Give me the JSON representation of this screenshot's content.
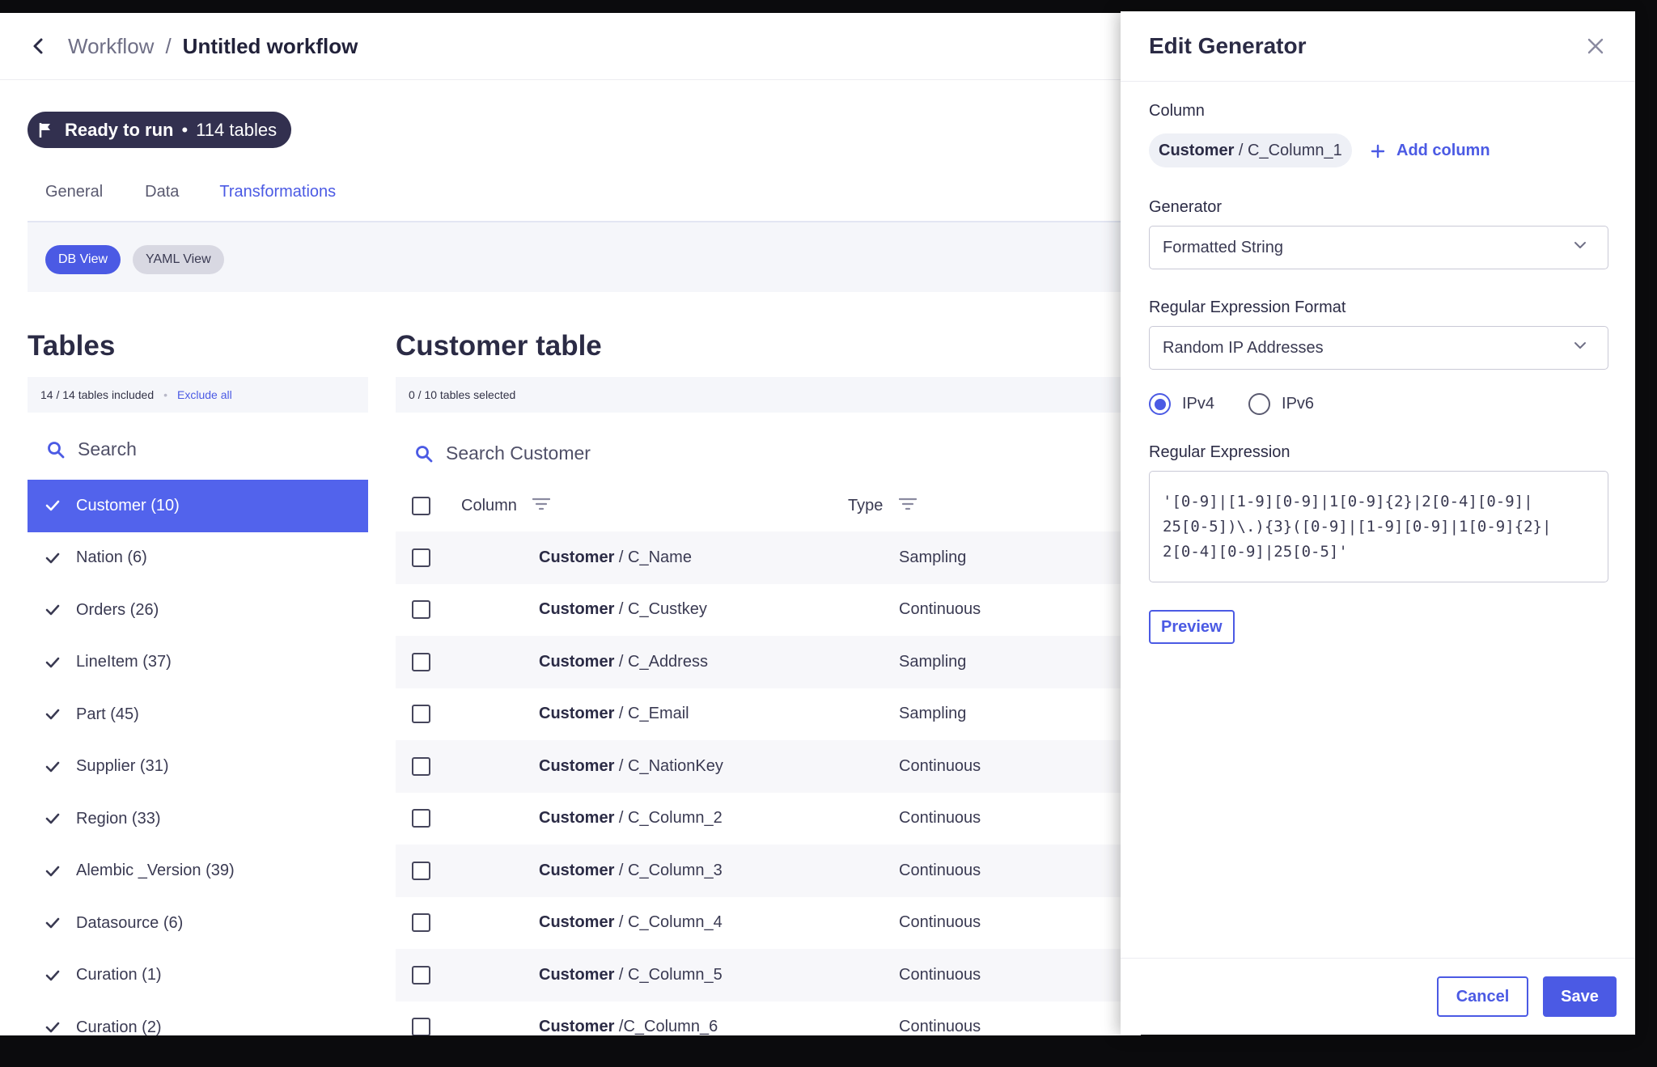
{
  "header": {
    "breadcrumb_parent": "Workflow",
    "breadcrumb_sep": "/",
    "breadcrumb_current": "Untitled workflow"
  },
  "status": {
    "label": "Ready to run",
    "separator": "•",
    "count": "114 tables"
  },
  "tabs": [
    {
      "label": "General",
      "active": false
    },
    {
      "label": "Data",
      "active": false
    },
    {
      "label": "Transformations",
      "active": true
    }
  ],
  "views": {
    "db": "DB View",
    "yaml": "YAML View",
    "active": "DB View"
  },
  "tables_panel": {
    "title": "Tables",
    "summary": "14 / 14 tables included",
    "exclude_link": "Exclude all",
    "search_placeholder": "Search",
    "items": [
      {
        "label": "Customer (10)",
        "selected": true
      },
      {
        "label": "Nation (6)",
        "selected": false
      },
      {
        "label": "Orders (26)",
        "selected": false
      },
      {
        "label": "LineItem (37)",
        "selected": false
      },
      {
        "label": "Part (45)",
        "selected": false
      },
      {
        "label": "Supplier (31)",
        "selected": false
      },
      {
        "label": "Region (33)",
        "selected": false
      },
      {
        "label": "Alembic _Version (39)",
        "selected": false
      },
      {
        "label": "Datasource (6)",
        "selected": false
      },
      {
        "label": "Curation (1)",
        "selected": false
      },
      {
        "label": "Curation (2)",
        "selected": false
      }
    ]
  },
  "customer_table": {
    "title": "Customer table",
    "summary": "0 / 10 tables selected",
    "search_placeholder": "Search Customer",
    "col_header": "Column",
    "type_header": "Type",
    "rows": [
      {
        "table": "Customer",
        "sep": " / ",
        "column": "C_Name",
        "type": "Sampling"
      },
      {
        "table": "Customer",
        "sep": " / ",
        "column": "C_Custkey",
        "type": "Continuous"
      },
      {
        "table": "Customer",
        "sep": " / ",
        "column": "C_Address",
        "type": "Sampling"
      },
      {
        "table": "Customer",
        "sep": " / ",
        "column": "C_Email",
        "type": "Sampling"
      },
      {
        "table": "Customer",
        "sep": " / ",
        "column": "C_NationKey",
        "type": "Continuous"
      },
      {
        "table": "Customer",
        "sep": " / ",
        "column": "C_Column_2",
        "type": "Continuous"
      },
      {
        "table": "Customer",
        "sep": " / ",
        "column": "C_Column_3",
        "type": "Continuous"
      },
      {
        "table": "Customer",
        "sep": " / ",
        "column": "C_Column_4",
        "type": "Continuous"
      },
      {
        "table": "Customer",
        "sep": " / ",
        "column": "C_Column_5",
        "type": "Continuous"
      },
      {
        "table": "Customer",
        "sep": " /",
        "column": "C_Column_6",
        "type": "Continuous"
      }
    ]
  },
  "drawer": {
    "title": "Edit Generator",
    "column_label": "Column",
    "chip_table": "Customer",
    "chip_column": " / C_Column_1",
    "add_column": "Add column",
    "generator_label": "Generator",
    "generator_value": "Formatted String",
    "format_label": "Regular Expression Format",
    "format_value": "Random IP Addresses",
    "radio_ipv4": "IPv4",
    "radio_ipv6": "IPv6",
    "radio_selected": "IPv4",
    "regex_label": "Regular Expression",
    "regex_line1": "'[0-9]|[1-9][0-9]|1[0-9]{2}|2[0-4][0-9]|",
    "regex_line2": "25[0-5])\\.){3}([0-9]|[1-9][0-9]|1[0-9]{2}|",
    "regex_line3": "2[0-4][0-9]|25[0-5]'",
    "preview": "Preview",
    "cancel": "Cancel",
    "save": "Save"
  },
  "colors": {
    "accent": "#4b5ae4",
    "selected_row": "#5263ec",
    "status_pill": "#32304f"
  }
}
